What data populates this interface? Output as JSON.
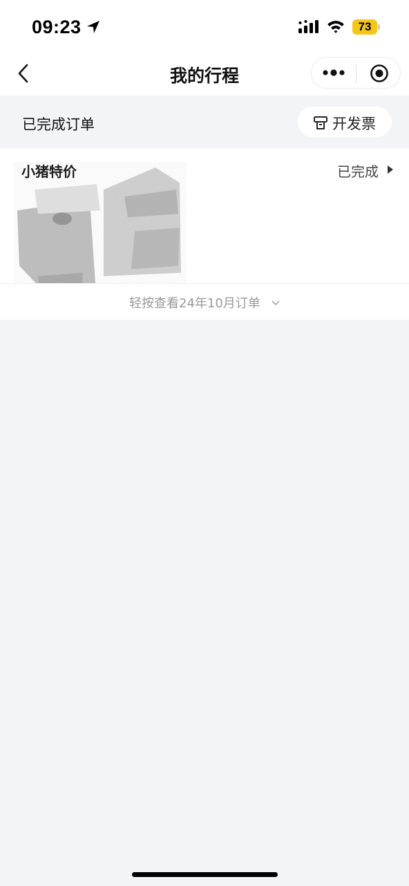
{
  "status_bar": {
    "time": "09:23",
    "battery_level": "73",
    "icons": [
      "location-arrow-icon",
      "cellular-signal-icon",
      "wifi-icon",
      "battery-icon"
    ],
    "battery_color": "#f5c518"
  },
  "nav": {
    "title": "我的行程",
    "icons": [
      "back-arrow-icon",
      "more-dots-icon",
      "target-circle-icon"
    ]
  },
  "section": {
    "title": "已完成订单",
    "invoice_button_label": "开发票",
    "invoice_icon": "invoice-printer-icon"
  },
  "order": {
    "merchant": "小猪特价",
    "status": "已完成"
  },
  "footer": {
    "expand_label": "轻按查看24年10月订单"
  },
  "colors": {
    "page_background": "#f3f4f8",
    "card_background": "#ffffff",
    "muted_text": "#999999"
  }
}
